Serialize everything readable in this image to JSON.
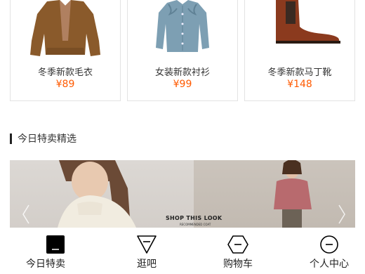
{
  "products": [
    {
      "name": "冬季新款毛衣",
      "price": "¥89",
      "image": "brown-cardigan"
    },
    {
      "name": "女装新款衬衫",
      "price": "¥99",
      "image": "blue-ruffle-blouse"
    },
    {
      "name": "冬季新款马丁靴",
      "price": "¥148",
      "image": "brown-leather-boot"
    }
  ],
  "section": {
    "title": "今日特卖精选"
  },
  "banner": {
    "headline": "SHOP THIS LOOK",
    "subline": "RECOMMENDED COAT"
  },
  "tabbar": {
    "items": [
      {
        "label": "今日特卖",
        "icon": "dash-square-icon"
      },
      {
        "label": "逛吧",
        "icon": "triangle-icon"
      },
      {
        "label": "购物车",
        "icon": "hexagon-icon"
      },
      {
        "label": "个人中心",
        "icon": "circle-icon"
      }
    ]
  },
  "colors": {
    "price": "#ff5a00",
    "text": "#333333",
    "border": "#e3e3e3"
  }
}
